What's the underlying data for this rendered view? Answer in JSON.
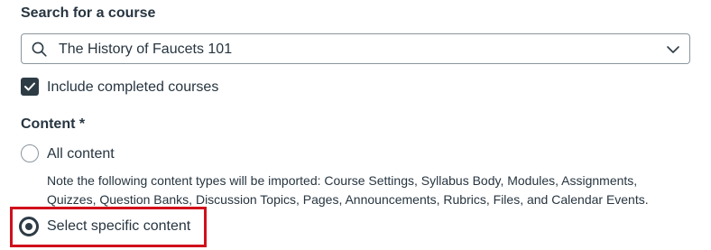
{
  "search": {
    "label": "Search for a course",
    "value": "The History of Faucets 101"
  },
  "include_completed": {
    "label": "Include completed courses",
    "checked": true
  },
  "content": {
    "label": "Content *",
    "options": [
      {
        "label": "All content",
        "selected": false
      },
      {
        "label": "Select specific content",
        "selected": true
      }
    ],
    "note": "Note the following content types will be imported: Course Settings, Syllabus Body, Modules, Assignments, Quizzes, Question Banks, Discussion Topics, Pages, Announcements, Rubrics, Files, and Calendar Events."
  },
  "colors": {
    "text": "#273540",
    "border": "#8b969e",
    "highlight": "#d0101b"
  },
  "icons": {
    "search": "search-icon",
    "dropdown": "chevron-down-icon",
    "checkbox": "checkmark-icon"
  }
}
